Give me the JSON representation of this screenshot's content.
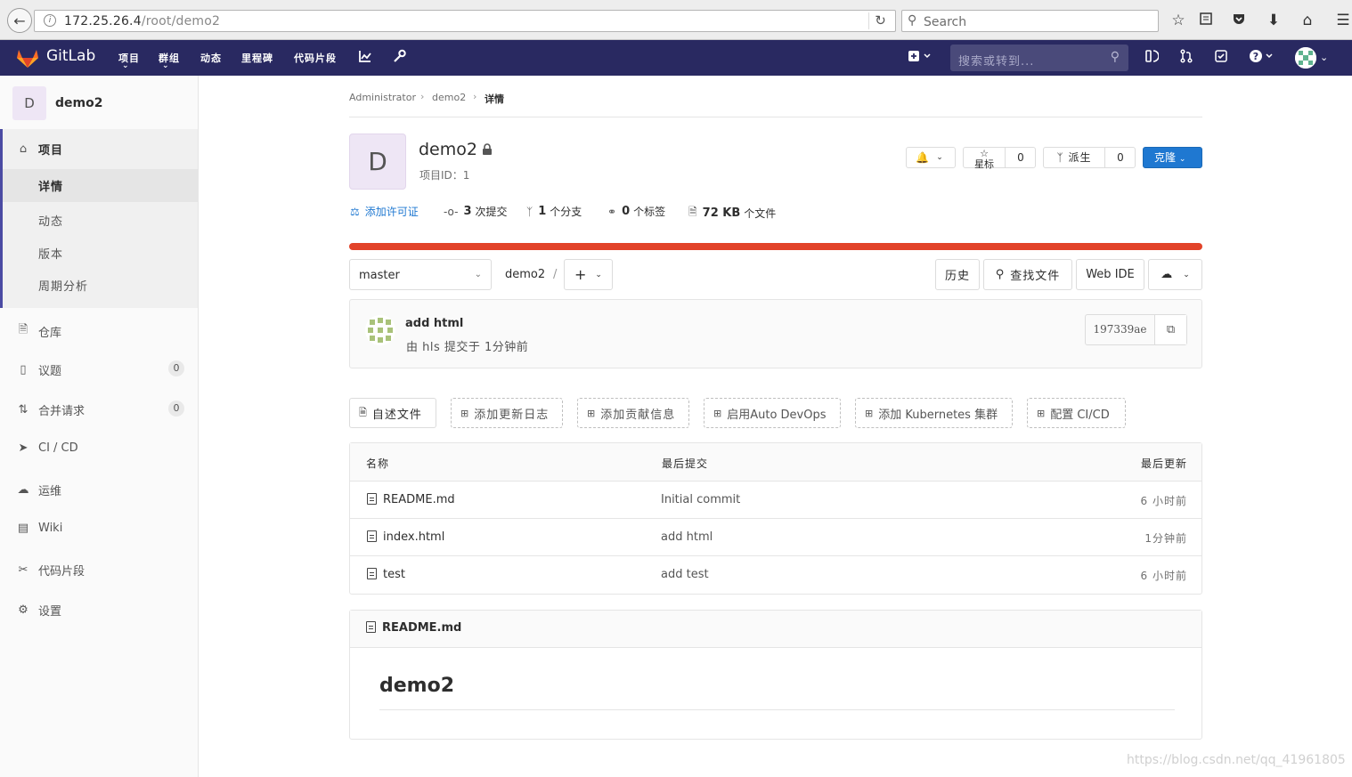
{
  "browser": {
    "url_host": "172.25.26.4",
    "url_path": "/root/demo2",
    "search_placeholder": "Search"
  },
  "header": {
    "brand": "GitLab",
    "nav": [
      "项目",
      "群组",
      "动态",
      "里程碑",
      "代码片段"
    ],
    "search_placeholder": "搜索或转到..."
  },
  "sidebar": {
    "project_initial": "D",
    "project_name": "demo2",
    "group_label": "项目",
    "sub_items": [
      "详情",
      "动态",
      "版本",
      "周期分析"
    ],
    "items": [
      {
        "label": "仓库"
      },
      {
        "label": "议题",
        "badge": "0"
      },
      {
        "label": "合并请求",
        "badge": "0"
      },
      {
        "label": "CI / CD"
      },
      {
        "label": "运维"
      },
      {
        "label": "Wiki"
      },
      {
        "label": "代码片段"
      },
      {
        "label": "设置"
      }
    ]
  },
  "breadcrumb": [
    "Administrator",
    "demo2",
    "详情"
  ],
  "project": {
    "initial": "D",
    "name": "demo2",
    "id_text": "项目ID：1",
    "star_label": "星标",
    "star_count": "0",
    "fork_label": "派生",
    "fork_count": "0",
    "clone_label": "克隆"
  },
  "stats": {
    "license": "添加许可证",
    "commits_num": "3",
    "commits_label": "次提交",
    "branches_num": "1",
    "branches_label": "个分支",
    "tags_num": "0",
    "tags_label": "个标签",
    "size_num": "72 KB",
    "size_label": "个文件"
  },
  "toolbar": {
    "branch": "master",
    "path": "demo2",
    "path_sep": "/",
    "history": "历史",
    "find_file": "查找文件",
    "web_ide": "Web IDE"
  },
  "commit": {
    "title": "add html",
    "meta": "由 hls 提交于 1分钟前",
    "sha": "197339ae"
  },
  "quick_actions": [
    "自述文件",
    "添加更新日志",
    "添加贡献信息",
    "启用Auto DevOps",
    "添加 Kubernetes 集群",
    "配置 CI/CD"
  ],
  "files": {
    "headers": [
      "名称",
      "最后提交",
      "最后更新"
    ],
    "rows": [
      {
        "name": "README.md",
        "commit": "Initial commit",
        "updated": "6 小时前"
      },
      {
        "name": "index.html",
        "commit": "add html",
        "updated": "1分钟前"
      },
      {
        "name": "test",
        "commit": "add test",
        "updated": "6 小时前"
      }
    ]
  },
  "readme": {
    "file": "README.md",
    "heading": "demo2"
  },
  "watermark": "https://blog.csdn.net/qq_41961805",
  "colors": {
    "header_bg": "#292961",
    "accent": "#1f78d1",
    "progress": "#e24329"
  }
}
